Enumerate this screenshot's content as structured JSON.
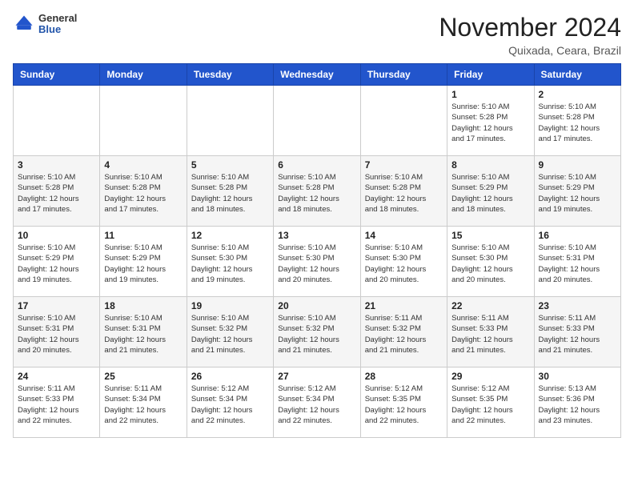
{
  "header": {
    "logo": {
      "general": "General",
      "blue": "Blue"
    },
    "title": "November 2024",
    "location": "Quixada, Ceara, Brazil"
  },
  "calendar": {
    "days_of_week": [
      "Sunday",
      "Monday",
      "Tuesday",
      "Wednesday",
      "Thursday",
      "Friday",
      "Saturday"
    ],
    "weeks": [
      [
        {
          "day": "",
          "info": ""
        },
        {
          "day": "",
          "info": ""
        },
        {
          "day": "",
          "info": ""
        },
        {
          "day": "",
          "info": ""
        },
        {
          "day": "",
          "info": ""
        },
        {
          "day": "1",
          "info": "Sunrise: 5:10 AM\nSunset: 5:28 PM\nDaylight: 12 hours\nand 17 minutes."
        },
        {
          "day": "2",
          "info": "Sunrise: 5:10 AM\nSunset: 5:28 PM\nDaylight: 12 hours\nand 17 minutes."
        }
      ],
      [
        {
          "day": "3",
          "info": "Sunrise: 5:10 AM\nSunset: 5:28 PM\nDaylight: 12 hours\nand 17 minutes."
        },
        {
          "day": "4",
          "info": "Sunrise: 5:10 AM\nSunset: 5:28 PM\nDaylight: 12 hours\nand 17 minutes."
        },
        {
          "day": "5",
          "info": "Sunrise: 5:10 AM\nSunset: 5:28 PM\nDaylight: 12 hours\nand 18 minutes."
        },
        {
          "day": "6",
          "info": "Sunrise: 5:10 AM\nSunset: 5:28 PM\nDaylight: 12 hours\nand 18 minutes."
        },
        {
          "day": "7",
          "info": "Sunrise: 5:10 AM\nSunset: 5:28 PM\nDaylight: 12 hours\nand 18 minutes."
        },
        {
          "day": "8",
          "info": "Sunrise: 5:10 AM\nSunset: 5:29 PM\nDaylight: 12 hours\nand 18 minutes."
        },
        {
          "day": "9",
          "info": "Sunrise: 5:10 AM\nSunset: 5:29 PM\nDaylight: 12 hours\nand 19 minutes."
        }
      ],
      [
        {
          "day": "10",
          "info": "Sunrise: 5:10 AM\nSunset: 5:29 PM\nDaylight: 12 hours\nand 19 minutes."
        },
        {
          "day": "11",
          "info": "Sunrise: 5:10 AM\nSunset: 5:29 PM\nDaylight: 12 hours\nand 19 minutes."
        },
        {
          "day": "12",
          "info": "Sunrise: 5:10 AM\nSunset: 5:30 PM\nDaylight: 12 hours\nand 19 minutes."
        },
        {
          "day": "13",
          "info": "Sunrise: 5:10 AM\nSunset: 5:30 PM\nDaylight: 12 hours\nand 20 minutes."
        },
        {
          "day": "14",
          "info": "Sunrise: 5:10 AM\nSunset: 5:30 PM\nDaylight: 12 hours\nand 20 minutes."
        },
        {
          "day": "15",
          "info": "Sunrise: 5:10 AM\nSunset: 5:30 PM\nDaylight: 12 hours\nand 20 minutes."
        },
        {
          "day": "16",
          "info": "Sunrise: 5:10 AM\nSunset: 5:31 PM\nDaylight: 12 hours\nand 20 minutes."
        }
      ],
      [
        {
          "day": "17",
          "info": "Sunrise: 5:10 AM\nSunset: 5:31 PM\nDaylight: 12 hours\nand 20 minutes."
        },
        {
          "day": "18",
          "info": "Sunrise: 5:10 AM\nSunset: 5:31 PM\nDaylight: 12 hours\nand 21 minutes."
        },
        {
          "day": "19",
          "info": "Sunrise: 5:10 AM\nSunset: 5:32 PM\nDaylight: 12 hours\nand 21 minutes."
        },
        {
          "day": "20",
          "info": "Sunrise: 5:10 AM\nSunset: 5:32 PM\nDaylight: 12 hours\nand 21 minutes."
        },
        {
          "day": "21",
          "info": "Sunrise: 5:11 AM\nSunset: 5:32 PM\nDaylight: 12 hours\nand 21 minutes."
        },
        {
          "day": "22",
          "info": "Sunrise: 5:11 AM\nSunset: 5:33 PM\nDaylight: 12 hours\nand 21 minutes."
        },
        {
          "day": "23",
          "info": "Sunrise: 5:11 AM\nSunset: 5:33 PM\nDaylight: 12 hours\nand 21 minutes."
        }
      ],
      [
        {
          "day": "24",
          "info": "Sunrise: 5:11 AM\nSunset: 5:33 PM\nDaylight: 12 hours\nand 22 minutes."
        },
        {
          "day": "25",
          "info": "Sunrise: 5:11 AM\nSunset: 5:34 PM\nDaylight: 12 hours\nand 22 minutes."
        },
        {
          "day": "26",
          "info": "Sunrise: 5:12 AM\nSunset: 5:34 PM\nDaylight: 12 hours\nand 22 minutes."
        },
        {
          "day": "27",
          "info": "Sunrise: 5:12 AM\nSunset: 5:34 PM\nDaylight: 12 hours\nand 22 minutes."
        },
        {
          "day": "28",
          "info": "Sunrise: 5:12 AM\nSunset: 5:35 PM\nDaylight: 12 hours\nand 22 minutes."
        },
        {
          "day": "29",
          "info": "Sunrise: 5:12 AM\nSunset: 5:35 PM\nDaylight: 12 hours\nand 22 minutes."
        },
        {
          "day": "30",
          "info": "Sunrise: 5:13 AM\nSunset: 5:36 PM\nDaylight: 12 hours\nand 23 minutes."
        }
      ]
    ]
  }
}
